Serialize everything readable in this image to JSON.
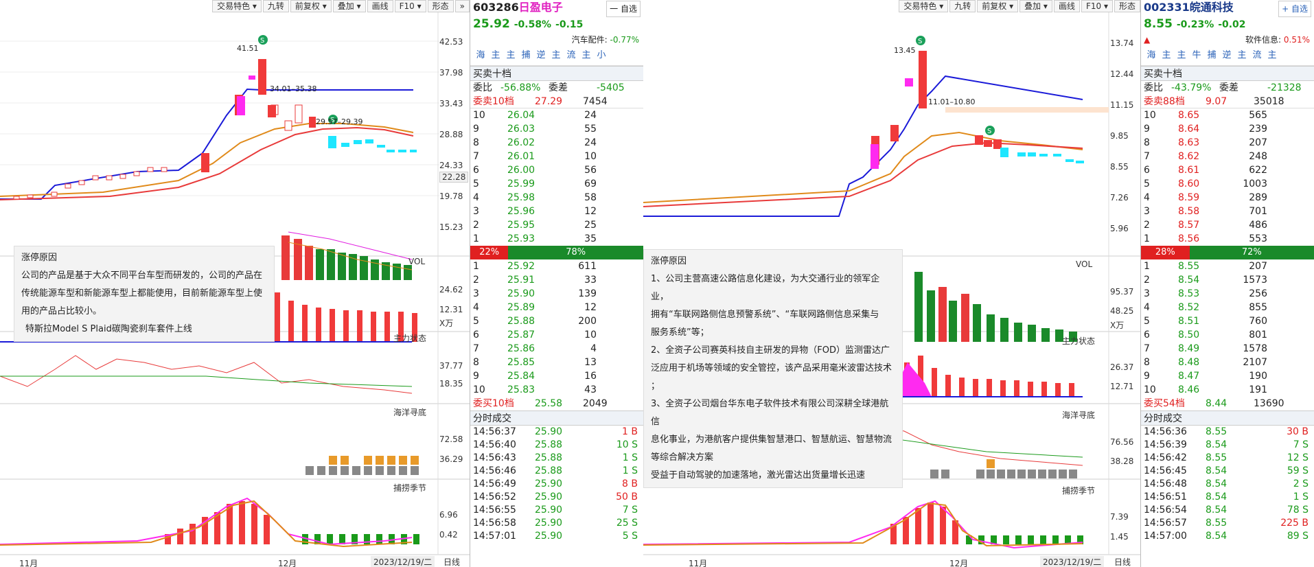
{
  "left": {
    "toolbar": [
      "交易特色 ▾",
      "九转",
      "前复权 ▾",
      "叠加 ▾",
      "画线",
      "F10 ▾",
      "形态"
    ],
    "price_axis": [
      "42.53",
      "37.98",
      "33.43",
      "28.88",
      "24.33",
      "19.78",
      "15.23"
    ],
    "current_price_tag": "22.28",
    "ann": {
      "high": "41.51",
      "band": "34.01–35.38",
      "band2": "29.57–29.39"
    },
    "vol": {
      "title": "VOL",
      "ticks": [
        "24.62",
        "12.31"
      ],
      "unit": "X万"
    },
    "ind1": {
      "title": "主力状态",
      "ticks": [
        "37.77",
        "18.35"
      ]
    },
    "ind2": {
      "title": "海洋寻底",
      "ticks": [
        "72.58",
        "36.29"
      ]
    },
    "ind3": {
      "title": "捕捞季节",
      "ticks": [
        "6.96",
        "0.42"
      ]
    },
    "x_axis": [
      "11月",
      "12月"
    ],
    "date": "2023/12/19/二",
    "period": "日线",
    "tooltip": {
      "title": "涨停原因",
      "lines": [
        "公司的产品是基于大众不同平台车型而研发的，公司的产品在",
        "传统能源车型和新能源车型上都能使用，目前新能源车型上使",
        "用的产品占比较小。"
      ],
      "extra": "特斯拉Model S Plaid碳陶瓷刹车套件上线"
    }
  },
  "stock1": {
    "code": "603286",
    "name": "日盈电子",
    "price": "25.92",
    "chg_pct": "-0.58%",
    "chg": "-0.15",
    "watch_label": "一 自选",
    "sector": "汽车配件:",
    "sector_chg": "-0.77%",
    "nav": [
      "海",
      "主",
      "主",
      "捕",
      "逆",
      "主",
      "流",
      "主",
      "小"
    ],
    "book_title": "买卖十档",
    "committee_ratio_label": "委比",
    "committee_ratio": "-56.88%",
    "committee_diff_label": "委差",
    "committee_diff": "-5405",
    "sell_label": "委卖10档",
    "sell_price": "27.29",
    "sell_vol": "7454",
    "sells": [
      [
        "10",
        "26.04",
        "24"
      ],
      [
        "9",
        "26.03",
        "55"
      ],
      [
        "8",
        "26.02",
        "24"
      ],
      [
        "7",
        "26.01",
        "10"
      ],
      [
        "6",
        "26.00",
        "56"
      ],
      [
        "5",
        "25.99",
        "69"
      ],
      [
        "4",
        "25.98",
        "58"
      ],
      [
        "3",
        "25.96",
        "12"
      ],
      [
        "2",
        "25.95",
        "25"
      ],
      [
        "1",
        "25.93",
        "35"
      ]
    ],
    "bar_left": "22%",
    "bar_right": "78%",
    "buys": [
      [
        "1",
        "25.92",
        "611"
      ],
      [
        "2",
        "25.91",
        "33"
      ],
      [
        "3",
        "25.90",
        "139"
      ],
      [
        "4",
        "25.89",
        "12"
      ],
      [
        "5",
        "25.88",
        "200"
      ],
      [
        "6",
        "25.87",
        "10"
      ],
      [
        "7",
        "25.86",
        "4"
      ],
      [
        "8",
        "25.85",
        "13"
      ],
      [
        "9",
        "25.84",
        "16"
      ],
      [
        "10",
        "25.83",
        "43"
      ]
    ],
    "buy_label": "委买10档",
    "buy_price": "25.58",
    "buy_vol": "2049",
    "ticks_title": "分时成交",
    "trades": [
      [
        "14:56:37",
        "25.90",
        "1 B"
      ],
      [
        "14:56:40",
        "25.88",
        "10 S"
      ],
      [
        "14:56:43",
        "25.88",
        "1 S"
      ],
      [
        "14:56:46",
        "25.88",
        "1 S"
      ],
      [
        "14:56:49",
        "25.90",
        "8 B"
      ],
      [
        "14:56:52",
        "25.90",
        "50 B"
      ],
      [
        "14:56:55",
        "25.90",
        "7 S"
      ],
      [
        "14:56:58",
        "25.90",
        "25 S"
      ],
      [
        "14:57:01",
        "25.90",
        "5 S"
      ]
    ]
  },
  "right": {
    "toolbar": [
      "交易特色 ▾",
      "九转",
      "前复权 ▾",
      "叠加 ▾",
      "画线",
      "F10 ▾",
      "形态"
    ],
    "price_axis": [
      "13.74",
      "12.44",
      "11.15",
      "9.85",
      "8.55",
      "7.26",
      "5.96"
    ],
    "ann": {
      "high": "13.45",
      "band": "11.01–10.80"
    },
    "vol": {
      "title": "VOL",
      "ticks": [
        "95.37",
        "48.25"
      ],
      "unit": "X万"
    },
    "ind1": {
      "title": "主力状态",
      "ticks": [
        "26.37",
        "12.71"
      ]
    },
    "ind2": {
      "title": "海洋寻底",
      "ticks": [
        "76.56",
        "38.28"
      ]
    },
    "ind3": {
      "title": "捕捞季节",
      "ticks": [
        "7.39",
        "1.45"
      ]
    },
    "x_axis": [
      "11月",
      "12月"
    ],
    "date": "2023/12/19/二",
    "period": "日线",
    "tooltip": {
      "title": "涨停原因",
      "lines": [
        "1、公司主营高速公路信息化建设，为大交通行业的领军企业，",
        "拥有“车联网路侧信息预警系统”、“车联网路侧信息采集与",
        "服务系统”等；",
        "2、全资子公司赛英科技自主研发的异物（FOD）监测雷达广",
        "泛应用于机场等领域的安全管控，该产品采用毫米波雷达技术",
        "；",
        "3、全资子公司烟台华东电子软件技术有限公司深耕全球港航信",
        "息化事业，为港航客户提供集智慧港口、智慧航运、智慧物流",
        "等综合解决方案"
      ],
      "extra": "受益于自动驾驶的加速落地，激光雷达出货量增长迅速"
    }
  },
  "stock2": {
    "code": "002331",
    "name": "皖通科技",
    "price": "8.55",
    "chg_pct": "-0.23%",
    "chg": "-0.02",
    "watch_label": "+ 自选",
    "sector": "软件信息:",
    "sector_chg": "0.51%",
    "nav": [
      "海",
      "主",
      "主",
      "牛",
      "捕",
      "逆",
      "主",
      "流",
      "主"
    ],
    "book_title": "买卖十档",
    "committee_ratio_label": "委比",
    "committee_ratio": "-43.79%",
    "committee_diff_label": "委差",
    "committee_diff": "-21328",
    "sell_label": "委卖88档",
    "sell_price": "9.07",
    "sell_vol": "35018",
    "sells": [
      [
        "10",
        "8.65",
        "565"
      ],
      [
        "9",
        "8.64",
        "239"
      ],
      [
        "8",
        "8.63",
        "207"
      ],
      [
        "7",
        "8.62",
        "248"
      ],
      [
        "6",
        "8.61",
        "622"
      ],
      [
        "5",
        "8.60",
        "1003"
      ],
      [
        "4",
        "8.59",
        "289"
      ],
      [
        "3",
        "8.58",
        "701"
      ],
      [
        "2",
        "8.57",
        "486"
      ],
      [
        "1",
        "8.56",
        "553"
      ]
    ],
    "bar_left": "28%",
    "bar_right": "72%",
    "buys": [
      [
        "1",
        "8.55",
        "207"
      ],
      [
        "2",
        "8.54",
        "1573"
      ],
      [
        "3",
        "8.53",
        "256"
      ],
      [
        "4",
        "8.52",
        "855"
      ],
      [
        "5",
        "8.51",
        "760"
      ],
      [
        "6",
        "8.50",
        "801"
      ],
      [
        "7",
        "8.49",
        "1578"
      ],
      [
        "8",
        "8.48",
        "2107"
      ],
      [
        "9",
        "8.47",
        "190"
      ],
      [
        "10",
        "8.46",
        "191"
      ]
    ],
    "buy_label": "委买54档",
    "buy_price": "8.44",
    "buy_vol": "13690",
    "ticks_title": "分时成交",
    "trades": [
      [
        "14:56:36",
        "8.55",
        "30 B"
      ],
      [
        "14:56:39",
        "8.54",
        "7 S"
      ],
      [
        "14:56:42",
        "8.55",
        "12 S"
      ],
      [
        "14:56:45",
        "8.54",
        "59 S"
      ],
      [
        "14:56:48",
        "8.54",
        "2 S"
      ],
      [
        "14:56:51",
        "8.54",
        "1 S"
      ],
      [
        "14:56:54",
        "8.54",
        "78 S"
      ],
      [
        "14:56:57",
        "8.55",
        "225 B"
      ],
      [
        "14:57:00",
        "8.54",
        "89 S"
      ]
    ]
  }
}
